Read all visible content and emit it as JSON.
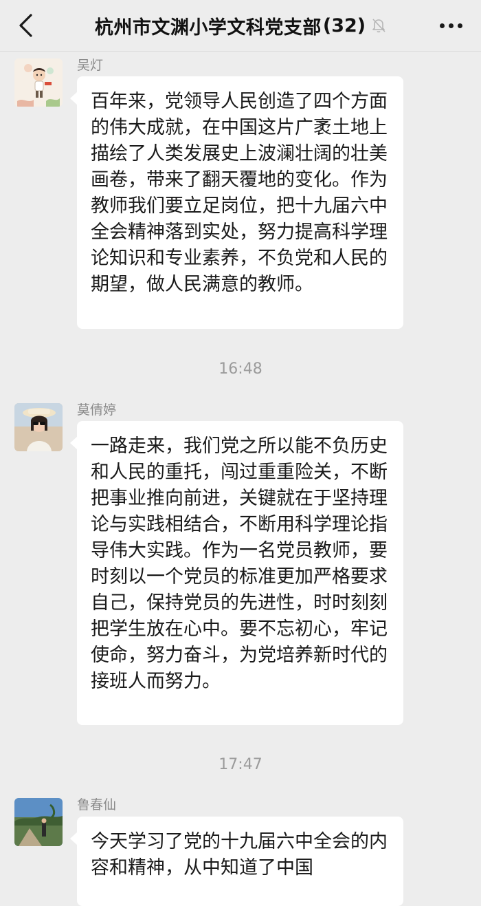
{
  "header": {
    "title": "杭州市文渊小学文科党支部",
    "member_count": "(32)",
    "back_icon": "back-chevron-icon",
    "mute_icon": "bell-muted-icon",
    "more_icon": "more-dots-icon"
  },
  "messages": [
    {
      "sender": "吴灯",
      "text": "百年来，党领导人民创造了四个方面的伟大成就，在中国这片广袤土地上描绘了人类发展史上波澜壮阔的壮美画卷，带来了翻天覆地的变化。作为教师我们要立足岗位，把十九届六中全会精神落到实处，努力提高科学理论知识和专业素养，不负党和人民的期望，做人民满意的教师。"
    },
    {
      "time": "16:48",
      "sender": "莫倩婷",
      "text": "一路走来，我们党之所以能不负历史和人民的重托，闯过重重险关，不断把事业推向前进，关键就在于坚持理论与实践相结合，不断用科学理论指导伟大实践。作为一名党员教师，要时刻以一个党员的标准更加严格要求自己，保持党员的先进性，时时刻刻把学生放在心中。要不忘初心，牢记使命，努力奋斗，为党培养新时代的接班人而努力。"
    },
    {
      "time": "17:47",
      "sender": "鲁春仙",
      "text": "今天学习了党的十九届六中全会的内容和精神，从中知道了中国"
    }
  ]
}
